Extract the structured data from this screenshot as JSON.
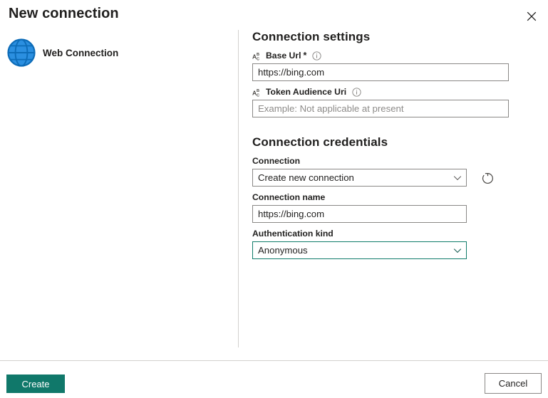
{
  "dialog": {
    "title": "New connection",
    "close_label": "Close",
    "close_icon": "close-icon"
  },
  "left_pane": {
    "connection_type": {
      "label": "Web Connection",
      "icon": "globe-icon"
    }
  },
  "connection_settings": {
    "heading": "Connection settings",
    "fields": [
      {
        "label": "Base Url",
        "required_marker": "*",
        "type_icon": "abc-text-type-icon",
        "info_icon": "info-circle-icon",
        "value": "https://bing.com",
        "placeholder": ""
      },
      {
        "label": "Token Audience Uri",
        "required_marker": "",
        "type_icon": "abc-text-type-icon",
        "info_icon": "info-circle-icon",
        "value": "",
        "placeholder": "Example: Not applicable at present"
      }
    ]
  },
  "connection_credentials": {
    "heading": "Connection credentials",
    "connection": {
      "label": "Connection",
      "value": "Create new connection",
      "options": [
        "Create new connection"
      ],
      "chevron_icon": "chevron-down-icon",
      "refresh_icon": "refresh-icon",
      "refresh_label": "Refresh"
    },
    "connection_name": {
      "label": "Connection name",
      "value": "https://bing.com",
      "placeholder": ""
    },
    "authentication_kind": {
      "label": "Authentication kind",
      "value": "Anonymous",
      "options": [
        "Anonymous"
      ],
      "chevron_icon": "chevron-down-icon",
      "focused": true
    }
  },
  "footer": {
    "create_label": "Create",
    "cancel_label": "Cancel"
  },
  "colors": {
    "accent": "#10786a",
    "globe_fill": "#1f86d9",
    "globe_line": "#0d6cb8",
    "border": "#8a8886",
    "divider": "#d2d0ce",
    "text": "#201f1e",
    "placeholder": "#8d8b89"
  }
}
